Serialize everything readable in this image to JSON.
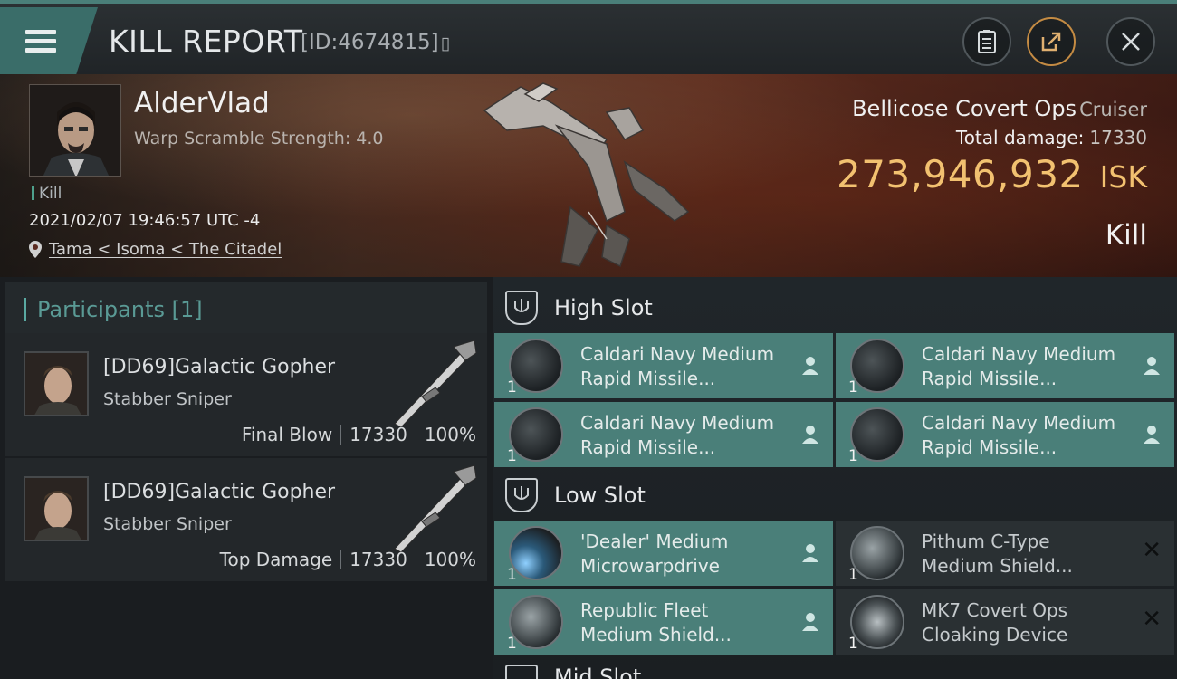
{
  "header": {
    "title": "KILL REPORT",
    "report_id": "[ID:4674815]",
    "icons": [
      "menu-icon",
      "copy-icon",
      "clipboard-icon",
      "share-icon",
      "close-icon"
    ]
  },
  "victim": {
    "name": "AlderVlad",
    "scramble": "Warp Scramble Strength: 4.0",
    "kill_tag": "Kill",
    "datetime": "2021/02/07 19:46:57 UTC -4",
    "location": "Tama < Isoma < The Citadel",
    "ship_name": "Bellicose Covert Ops",
    "ship_class": "Cruiser",
    "total_damage_label": "Total damage:",
    "total_damage": "17330",
    "isk_value": "273,946,932",
    "isk_unit": "ISK",
    "result": "Kill"
  },
  "participants": {
    "header": "Participants",
    "count": "[1]",
    "rows": [
      {
        "name": "[DD69]Galactic Gopher",
        "ship": "Stabber Sniper",
        "role": "Final Blow",
        "damage": "17330",
        "percent": "100%"
      },
      {
        "name": "[DD69]Galactic Gopher",
        "ship": "Stabber Sniper",
        "role": "Top Damage",
        "damage": "17330",
        "percent": "100%"
      }
    ]
  },
  "slots": {
    "high": {
      "label": "High Slot",
      "modules": [
        {
          "line1": "Caldari Navy Medium",
          "line2": "Rapid Missile...",
          "qty": "1",
          "state": "dropped"
        },
        {
          "line1": "Caldari Navy Medium",
          "line2": "Rapid Missile...",
          "qty": "1",
          "state": "dropped"
        },
        {
          "line1": "Caldari Navy Medium",
          "line2": "Rapid Missile...",
          "qty": "1",
          "state": "dropped"
        },
        {
          "line1": "Caldari Navy Medium",
          "line2": "Rapid Missile...",
          "qty": "1",
          "state": "dropped"
        }
      ]
    },
    "low": {
      "label": "Low Slot",
      "modules": [
        {
          "line1": "'Dealer' Medium",
          "line2": "Microwarpdrive",
          "qty": "1",
          "state": "dropped"
        },
        {
          "line1": "Pithum C-Type",
          "line2": "Medium Shield...",
          "qty": "1",
          "state": "destroyed"
        },
        {
          "line1": "Republic Fleet",
          "line2": "Medium Shield...",
          "qty": "1",
          "state": "dropped"
        },
        {
          "line1": "MK7 Covert Ops",
          "line2": "Cloaking Device",
          "qty": "1",
          "state": "destroyed"
        }
      ]
    },
    "mid": {
      "label": "Mid Slot"
    }
  },
  "colors": {
    "accent_teal": "#4a7f79",
    "isk_gold": "#f2c170",
    "destroyed_bg": "#2a3033"
  }
}
